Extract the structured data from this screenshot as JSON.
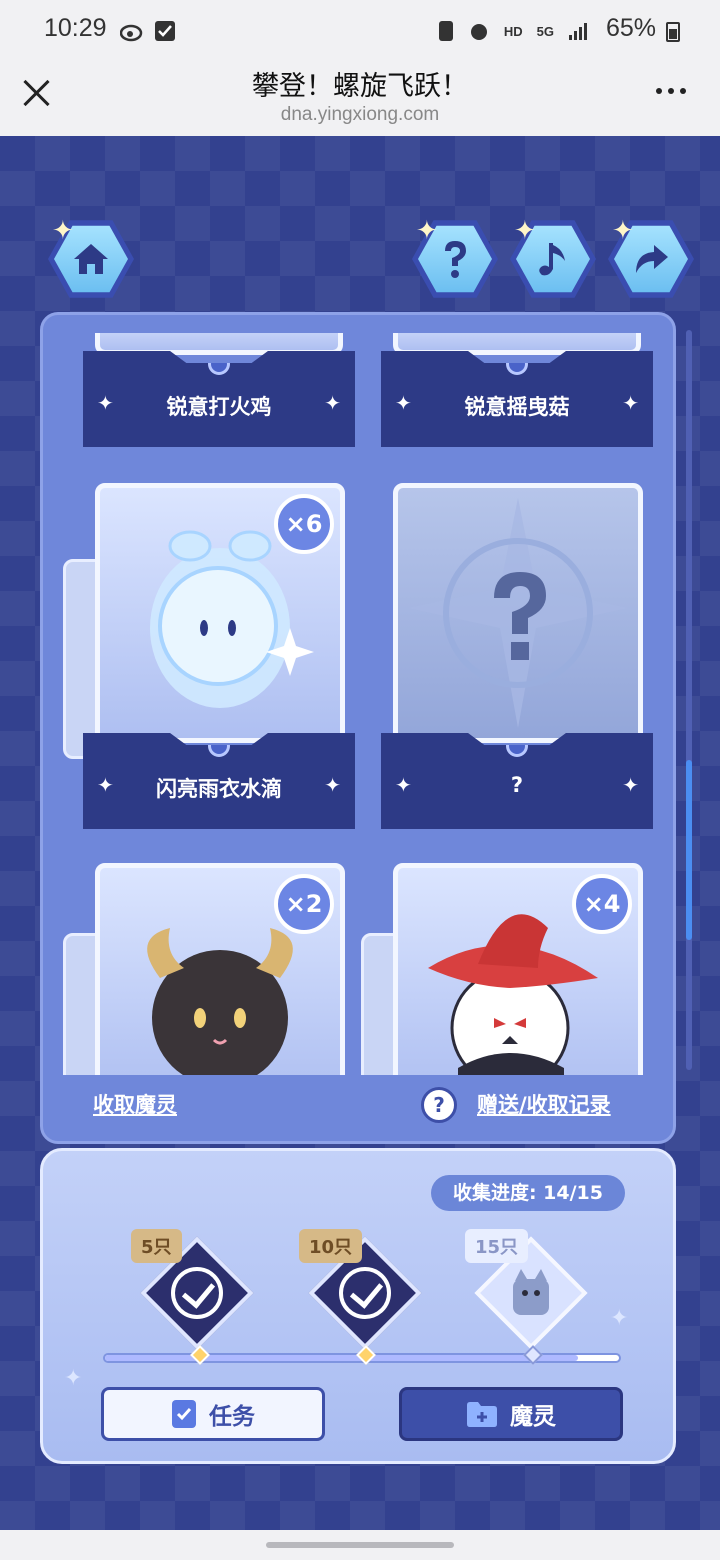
{
  "status": {
    "time": "10:29",
    "battery": "65%",
    "network": "5G",
    "hd": "HD"
  },
  "browser": {
    "title": "攀登！螺旋飞跃！",
    "url": "dna.yingxiong.com"
  },
  "cards": [
    {
      "name": "锐意打火鸡",
      "count": "",
      "state": "partial"
    },
    {
      "name": "锐意摇曳菇",
      "count": "",
      "state": "partial"
    },
    {
      "name": "闪亮雨衣水滴",
      "count": "×6",
      "state": "owned"
    },
    {
      "name": "?",
      "count": "",
      "state": "locked"
    },
    {
      "name": "",
      "count": "×2",
      "state": "owned"
    },
    {
      "name": "",
      "count": "×4",
      "state": "owned"
    }
  ],
  "links": {
    "receive": "收取魔灵",
    "history": "赠送/收取记录",
    "help": "?"
  },
  "progress": {
    "label": "收集进度: 14/15",
    "milestones": [
      {
        "flag": "5只",
        "done": true
      },
      {
        "flag": "10只",
        "done": true
      },
      {
        "flag": "15只",
        "done": false
      }
    ]
  },
  "buttons": {
    "task": "任务",
    "spirit": "魔灵"
  },
  "colors": {
    "game_bg": "#33418f",
    "panel": "#6f87da",
    "accent": "#3d4fa8",
    "gold": "#d6b987"
  },
  "icons": [
    "home-icon",
    "question-icon",
    "music-icon",
    "share-icon",
    "task-icon",
    "folder-icon"
  ]
}
